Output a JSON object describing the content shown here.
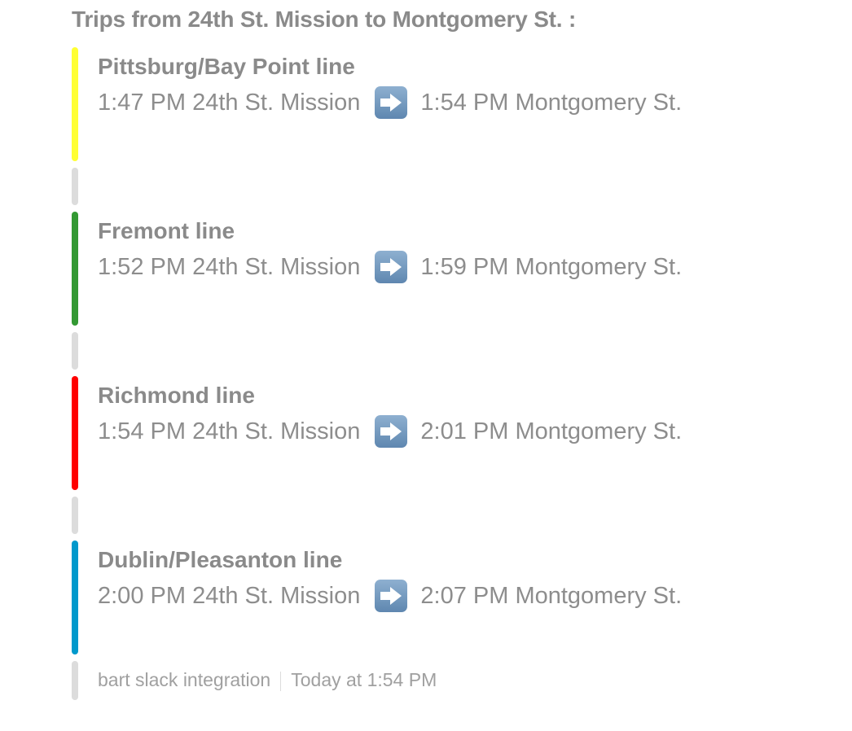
{
  "header": {
    "title": "Trips from 24th St. Mission to Montgomery St. :"
  },
  "trips": [
    {
      "line": "Pittsburg/Bay Point line",
      "color": "#ffff33",
      "depart_time": "1:47 PM",
      "depart_station": "24th St. Mission",
      "arrive_time": "1:54 PM",
      "arrive_station": "Montgomery St."
    },
    {
      "line": "Fremont line",
      "color": "#339933",
      "depart_time": "1:52 PM",
      "depart_station": "24th St. Mission",
      "arrive_time": "1:59 PM",
      "arrive_station": "Montgomery St."
    },
    {
      "line": "Richmond line",
      "color": "#ff0000",
      "depart_time": "1:54 PM",
      "depart_station": "24th St. Mission",
      "arrive_time": "2:01 PM",
      "arrive_station": "Montgomery St."
    },
    {
      "line": "Dublin/Pleasanton line",
      "color": "#0099cc",
      "depart_time": "2:00 PM",
      "depart_station": "24th St. Mission",
      "arrive_time": "2:07 PM",
      "arrive_station": "Montgomery St."
    }
  ],
  "icons": {
    "arrow": "right-arrow-icon"
  },
  "footer": {
    "app_name": "bart slack integration",
    "timestamp": "Today at 1:54 PM"
  }
}
